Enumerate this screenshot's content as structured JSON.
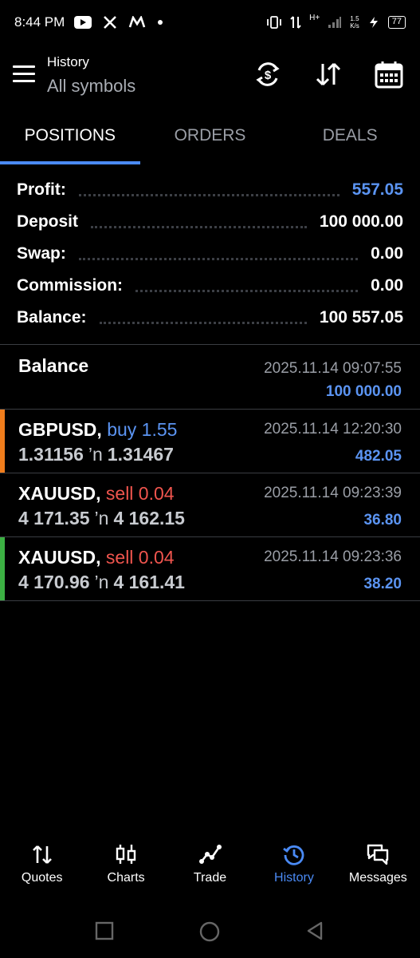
{
  "statusbar": {
    "time": "8:44 PM",
    "network": "H+",
    "speed_top": "1.5",
    "speed_bottom": "K/s",
    "battery": "77"
  },
  "header": {
    "title": "History",
    "subtitle": "All symbols"
  },
  "tabs": [
    {
      "label": "POSITIONS",
      "active": true
    },
    {
      "label": "ORDERS",
      "active": false
    },
    {
      "label": "DEALS",
      "active": false
    }
  ],
  "summary": {
    "profit_label": "Profit:",
    "profit_value": "557.05",
    "deposit_label": "Deposit",
    "deposit_value": "100 000.00",
    "swap_label": "Swap:",
    "swap_value": "0.00",
    "commission_label": "Commission:",
    "commission_value": "0.00",
    "balance_label": "Balance:",
    "balance_value": "100 557.05"
  },
  "balance_entry": {
    "label": "Balance",
    "time": "2025.11.14 09:07:55",
    "amount": "100 000.00"
  },
  "deals": [
    {
      "symbol": "GBPUSD,",
      "side": "buy 1.55",
      "open_price": "1.31156",
      "arrow": "’n",
      "close_price": "1.31467",
      "time": "2025.11.14 12:20:30",
      "amount": "482.05",
      "bar_color": "#f07d1c"
    },
    {
      "symbol": "XAUUSD,",
      "side": "sell 0.04",
      "open_price": "4 171.35",
      "arrow": "’n",
      "close_price": "4 162.15",
      "time": "2025.11.14 09:23:39",
      "amount": "36.80",
      "bar_color": ""
    },
    {
      "symbol": "XAUUSD,",
      "side": "sell 0.04",
      "open_price": "4 170.96",
      "arrow": "’n",
      "close_price": "4 161.41",
      "time": "2025.11.14 09:23:36",
      "amount": "38.20",
      "bar_color": "#3cb043"
    }
  ],
  "bottomnav": [
    {
      "label": "Quotes",
      "icon": "quotes-arrows-icon"
    },
    {
      "label": "Charts",
      "icon": "candlestick-icon"
    },
    {
      "label": "Trade",
      "icon": "trade-line-icon"
    },
    {
      "label": "History",
      "icon": "history-clock-icon",
      "active": true
    },
    {
      "label": "Messages",
      "icon": "chat-bubbles-icon"
    }
  ],
  "colors": {
    "accent": "#4a8af4",
    "profit_blue": "#5b94f2",
    "sell_red": "#f0554e",
    "buy_bar": "#f07d1c",
    "green_bar": "#3cb043"
  }
}
